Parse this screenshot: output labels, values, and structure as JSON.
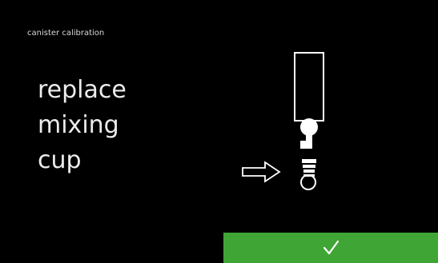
{
  "header": {
    "title": "canister calibration"
  },
  "main": {
    "instruction_lines": [
      "replace",
      "mixing",
      "cup"
    ],
    "illustration": {
      "icon": "mixing-cup-replacement-icon",
      "pointer_icon": "arrow-right-outline-icon"
    }
  },
  "footer": {
    "confirm_icon": "checkmark-icon",
    "confirm_color": "#3fa535"
  },
  "colors": {
    "background": "#000000",
    "text": "#ececec",
    "accent": "#3fa535"
  }
}
